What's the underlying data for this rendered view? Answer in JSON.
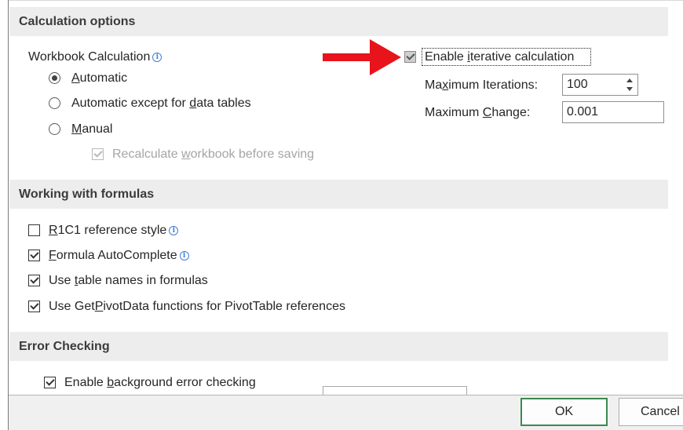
{
  "sections": {
    "calculation": {
      "title": "Calculation options"
    },
    "formulas": {
      "title": "Working with formulas"
    },
    "error": {
      "title": "Error Checking"
    }
  },
  "calculation": {
    "workbook_label": "Workbook Calculation",
    "options": [
      {
        "pre": "",
        "u": "A",
        "post": "utomatic",
        "selected": true
      },
      {
        "pre": "Automatic except for ",
        "u": "d",
        "post": "ata tables",
        "selected": false
      },
      {
        "pre": "",
        "u": "M",
        "post": "anual",
        "selected": false
      }
    ],
    "recalc": {
      "pre": "Recalculate ",
      "u": "w",
      "post": "orkbook before saving",
      "checked": true,
      "disabled": true
    },
    "iterative": {
      "pre": "Enable ",
      "u": "i",
      "post": "terative calculation",
      "checked": true
    },
    "max_iterations": {
      "pre": "Ma",
      "u": "x",
      "post": "imum Iterations:",
      "value": "100"
    },
    "max_change": {
      "pre": "Maximum ",
      "u": "C",
      "post": "hange:",
      "value": "0.001"
    }
  },
  "formulas": {
    "items": [
      {
        "pre": "",
        "u": "R",
        "post": "1C1 reference style",
        "checked": false,
        "info": true
      },
      {
        "pre": "",
        "u": "F",
        "post": "ormula AutoComplete",
        "checked": true,
        "info": true
      },
      {
        "pre": "Use ",
        "u": "t",
        "post": "able names in formulas",
        "checked": true,
        "info": false
      },
      {
        "pre": "Use Get",
        "u": "P",
        "post": "ivotData functions for PivotTable references",
        "checked": true,
        "info": false
      }
    ]
  },
  "error": {
    "background": {
      "pre": "Enable ",
      "u": "b",
      "post": "ackground error checking",
      "checked": true
    }
  },
  "buttons": {
    "ok": "OK",
    "cancel": "Cancel"
  },
  "icons": {
    "info": "info-icon",
    "arrow": "red-arrow-annotation"
  },
  "colors": {
    "arrow": "#e8141b",
    "ok_border": "#3c8a4e",
    "section_bg": "#ededed"
  }
}
